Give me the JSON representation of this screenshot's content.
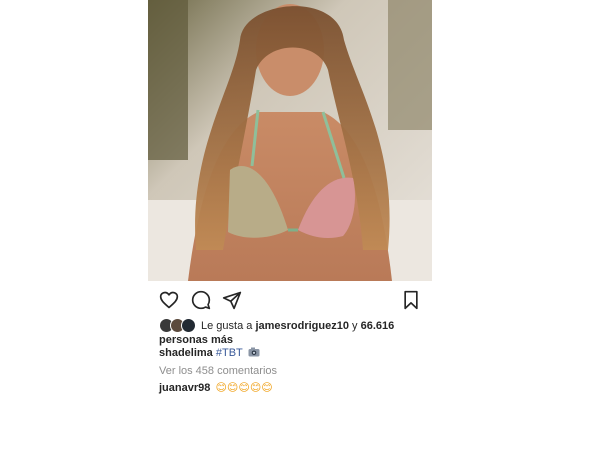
{
  "post": {
    "photo_alt": "",
    "likes": {
      "prefix": "Le gusta a",
      "user": "jamesrodriguez10",
      "connector": "y",
      "count": "66.616",
      "suffix": "personas más"
    },
    "caption": {
      "user": "shadelima",
      "hashtag": "#TBT"
    },
    "view_comments": "Ver los 458 comentarios",
    "comment": {
      "user": "juanavr98",
      "emojis": "😊😊😊😊😊"
    }
  },
  "icons": [
    "heart-icon",
    "comment-icon",
    "share-icon",
    "bookmark-icon",
    "camera-emoji"
  ],
  "colors": {
    "text": "#262626",
    "muted": "#8e8e8e",
    "link": "#385898",
    "emoji": "#f0a21a"
  }
}
